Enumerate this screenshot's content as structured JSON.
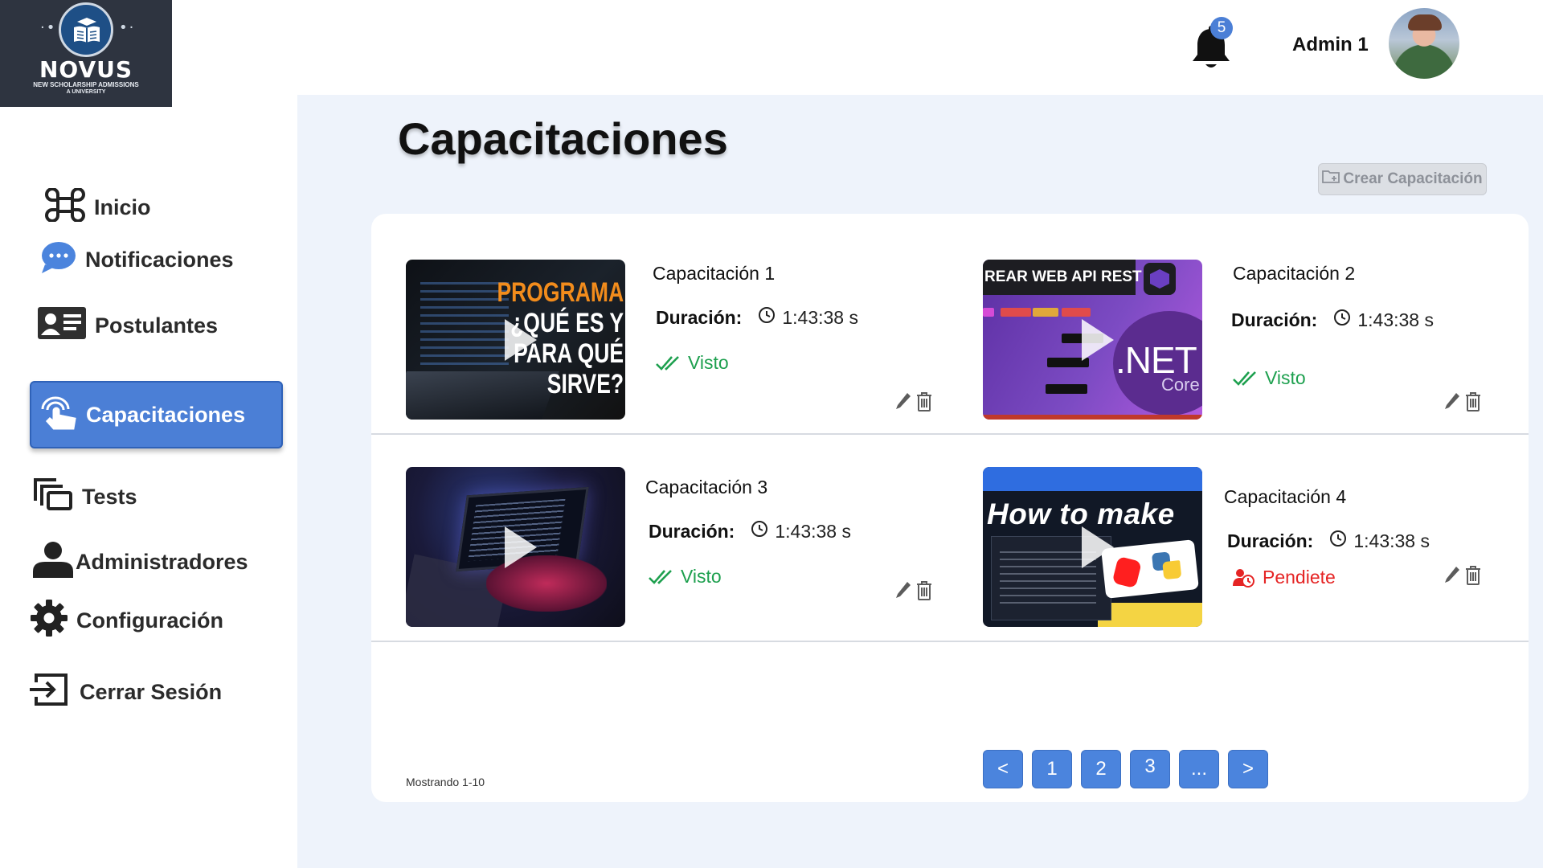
{
  "brand": {
    "name": "NOVUS",
    "subtitle_line1": "NEW SCHOLARSHIP ADMISSIONS",
    "subtitle_line2": "A UNIVERSITY",
    "accent_color": "#4b7fd6"
  },
  "header": {
    "notifications_count": "5",
    "user_name": "Admin 1"
  },
  "sidebar": {
    "items": [
      {
        "label": "Inicio",
        "icon": "command-icon",
        "active": false
      },
      {
        "label": "Notificaciones",
        "icon": "chat-bubble-icon",
        "active": false
      },
      {
        "label": "Postulantes",
        "icon": "id-card-icon",
        "active": false
      },
      {
        "label": "Capacitaciones",
        "icon": "touch-hand-icon",
        "active": true
      },
      {
        "label": "Tests",
        "icon": "stacked-windows-icon",
        "active": false
      },
      {
        "label": "Administradores",
        "icon": "person-icon",
        "active": false
      },
      {
        "label": "Configuración",
        "icon": "gear-icon",
        "active": false
      },
      {
        "label": "Cerrar Sesión",
        "icon": "logout-icon",
        "active": false
      }
    ]
  },
  "main": {
    "title": "Capacitaciones",
    "create_button": "Crear Capacitación",
    "trainings": [
      {
        "title": "Capacitación 1",
        "duration_label": "Duración:",
        "duration": "1:43:38 s",
        "status": "Visto",
        "status_type": "seen",
        "thumb_text_line1": "PROGRAMA",
        "thumb_text_line2": "¿QUÉ ES Y",
        "thumb_text_line3": "PARA QUÉ",
        "thumb_text_line4": "SIRVE?"
      },
      {
        "title": "Capacitación 2",
        "duration_label": "Duración:",
        "duration": "1:43:38 s",
        "status": "Visto",
        "status_type": "seen",
        "thumb_text_line1": "REAR WEB API REST",
        "thumb_text_line2": ".NET",
        "thumb_text_line3": "Core"
      },
      {
        "title": "Capacitación 3",
        "duration_label": "Duración:",
        "duration": "1:43:38 s",
        "status": "Visto",
        "status_type": "seen"
      },
      {
        "title": "Capacitación 4",
        "duration_label": "Duración:",
        "duration": "1:43:38 s",
        "status": "Pendiete",
        "status_type": "pending",
        "thumb_text_line1": "How to make"
      }
    ],
    "showing_text": "Mostrando 1-10",
    "pagination": [
      "<",
      "1",
      "2",
      "3",
      "...",
      ">"
    ]
  },
  "colors": {
    "seen": "#1ea04f",
    "pending": "#e52424",
    "pagination": "#4b84dd",
    "main_background": "#eef3fb"
  }
}
